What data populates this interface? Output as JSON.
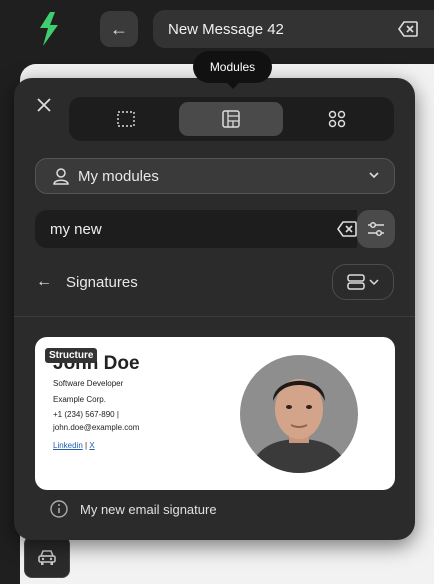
{
  "topbar": {
    "title": "New Message 42",
    "logo_color": "#4ad27a"
  },
  "tooltip": {
    "label": "Modules"
  },
  "panel": {
    "tabs": [
      {
        "name": "grid-dotted-icon",
        "active": false
      },
      {
        "name": "modules-icon",
        "active": true
      },
      {
        "name": "apps-icon",
        "active": false
      }
    ],
    "dropdown": {
      "label": "My modules"
    },
    "search": {
      "value": "my new"
    },
    "breadcrumb": {
      "title": "Signatures"
    }
  },
  "card": {
    "badge": "Structure",
    "name": "John Doe",
    "role": "Software Developer",
    "company": "Example Corp.",
    "phone": "+1 (234) 567-890 |",
    "email": "john.doe@example.com",
    "link1": "Linkedin",
    "link_sep": "|",
    "link2": "X",
    "caption": "My new email signature"
  }
}
